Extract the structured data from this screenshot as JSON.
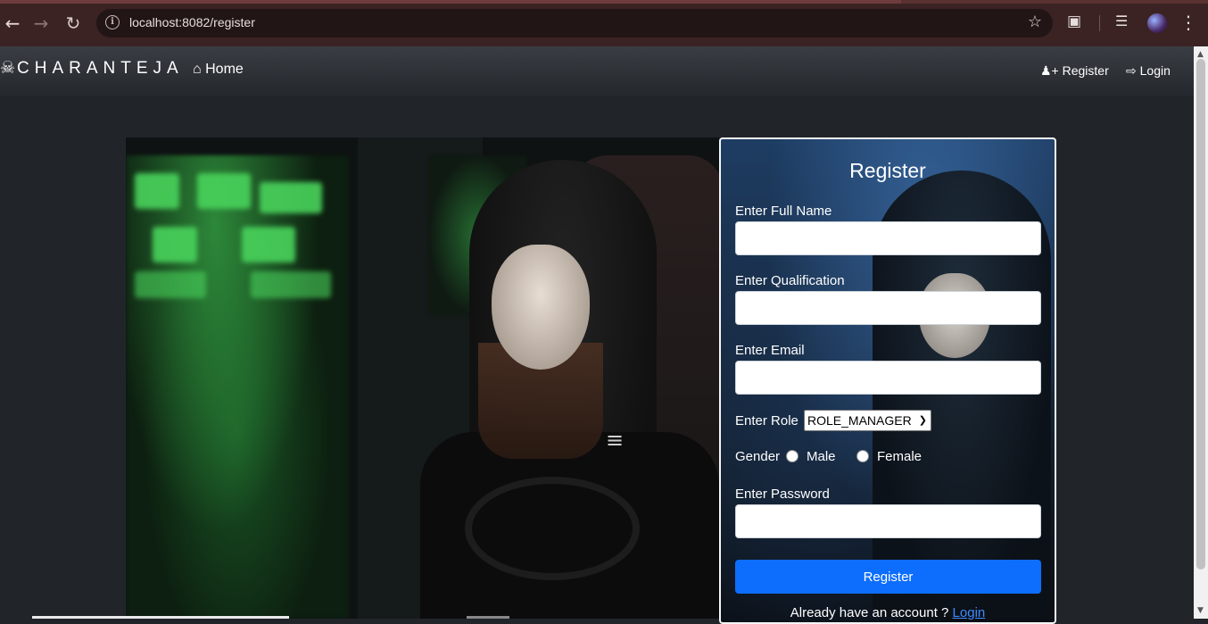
{
  "browser": {
    "url": "localhost:8082/register",
    "back_icon": "arrow-left-icon",
    "forward_icon": "arrow-right-icon",
    "reload_icon": "reload-icon",
    "bookmark_icon": "star-icon"
  },
  "navbar": {
    "brand": "CHARANTEJA",
    "home_label": "Home",
    "register_label": "Register",
    "login_label": "Login"
  },
  "form": {
    "title": "Register",
    "full_name_label": "Enter Full Name",
    "full_name_value": "",
    "qualification_label": "Enter Qualification",
    "qualification_value": "",
    "email_label": "Enter Email",
    "email_value": "",
    "role_label": "Enter Role",
    "role_selected": "ROLE_MANAGER",
    "gender_label": "Gender",
    "gender_options": [
      "Male",
      "Female"
    ],
    "password_label": "Enter Password",
    "password_value": "",
    "submit_label": "Register",
    "already_text": "Already have an account ?",
    "login_link": "Login"
  },
  "colors": {
    "page_bg": "#212529",
    "primary_button": "#0d6efd",
    "link": "#3d8bfd"
  }
}
